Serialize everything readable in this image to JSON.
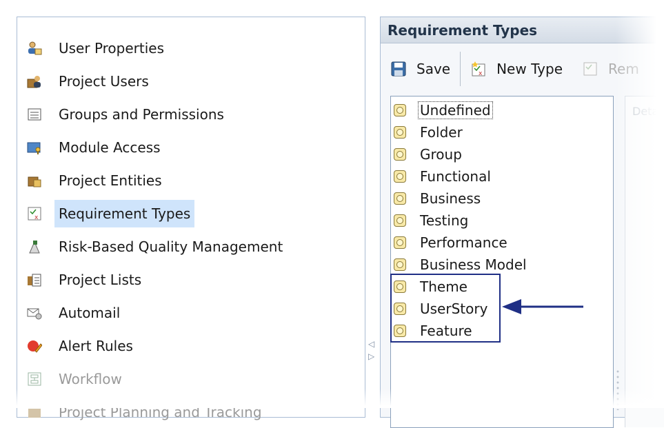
{
  "left_nav": {
    "items": [
      {
        "label": "User Properties",
        "icon": "user-properties-icon",
        "state": "normal"
      },
      {
        "label": "Project Users",
        "icon": "project-users-icon",
        "state": "normal"
      },
      {
        "label": "Groups and Permissions",
        "icon": "groups-permissions-icon",
        "state": "normal"
      },
      {
        "label": "Module Access",
        "icon": "module-access-icon",
        "state": "normal"
      },
      {
        "label": "Project Entities",
        "icon": "project-entities-icon",
        "state": "normal"
      },
      {
        "label": "Requirement Types",
        "icon": "requirement-types-icon",
        "state": "selected"
      },
      {
        "label": "Risk-Based Quality Management",
        "icon": "risk-quality-icon",
        "state": "normal"
      },
      {
        "label": "Project Lists",
        "icon": "project-lists-icon",
        "state": "normal"
      },
      {
        "label": "Automail",
        "icon": "automail-icon",
        "state": "normal"
      },
      {
        "label": "Alert Rules",
        "icon": "alert-rules-icon",
        "state": "normal"
      },
      {
        "label": "Workflow",
        "icon": "workflow-icon",
        "state": "disabled"
      },
      {
        "label": "Project Planning and Tracking",
        "icon": "project-planning-icon",
        "state": "disabled"
      }
    ]
  },
  "right_panel": {
    "title": "Requirement Types",
    "toolbar": {
      "save_label": "Save",
      "new_type_label": "New Type",
      "remove_label": "Rem"
    },
    "types": [
      {
        "label": "Undefined",
        "focused": true
      },
      {
        "label": "Folder"
      },
      {
        "label": "Group"
      },
      {
        "label": "Functional"
      },
      {
        "label": "Business"
      },
      {
        "label": "Testing"
      },
      {
        "label": "Performance"
      },
      {
        "label": "Business Model"
      },
      {
        "label": "Theme"
      },
      {
        "label": "UserStory"
      },
      {
        "label": "Feature"
      }
    ],
    "details_label": "Deta"
  },
  "colors": {
    "annotation": "#1f2f85",
    "selection": "#cfe4fb",
    "panel_border": "#a9bcd4"
  }
}
